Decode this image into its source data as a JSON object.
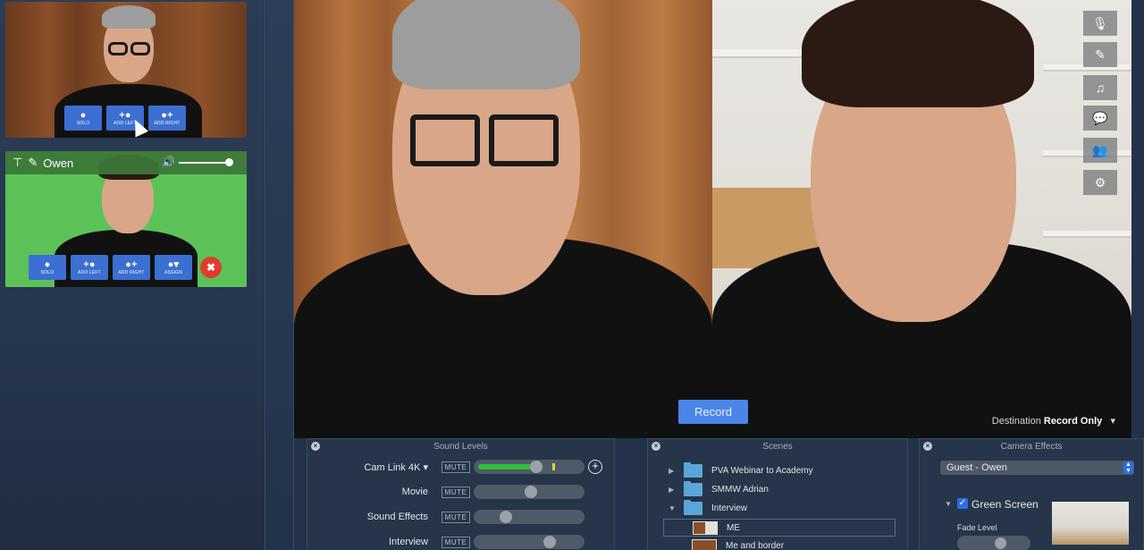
{
  "sidebar": {
    "host_thumb": {
      "buttons": [
        {
          "icon": "person-icon",
          "glyph": "👤",
          "label": "SOLO"
        },
        {
          "icon": "add-left-icon",
          "glyph": "+👤",
          "label": "ADD LEFT"
        },
        {
          "icon": "add-right-icon",
          "glyph": "👤+",
          "label": "ADD RIGHT"
        }
      ]
    },
    "guest_thumb": {
      "name": "Owen",
      "volume": 1.0,
      "buttons": [
        {
          "icon": "person-icon",
          "glyph": "👤",
          "label": "SOLO"
        },
        {
          "icon": "add-left-icon",
          "glyph": "+👤",
          "label": "ADD LEFT"
        },
        {
          "icon": "add-right-icon",
          "glyph": "👤+",
          "label": "ADD RIGHT"
        },
        {
          "icon": "assign-icon",
          "glyph": "👤▾",
          "label": "ASSIGN"
        }
      ],
      "remove_glyph": "✖"
    }
  },
  "stage": {
    "record_label": "Record",
    "destination_label": "Destination",
    "destination_value": "Record Only",
    "tools": [
      {
        "name": "audio-settings-icon",
        "glyph": "🎙"
      },
      {
        "name": "magic-wand-icon",
        "glyph": "✎"
      },
      {
        "name": "music-icon",
        "glyph": "♫"
      },
      {
        "name": "chat-icon",
        "glyph": "💬"
      },
      {
        "name": "guests-icon",
        "glyph": "👥"
      },
      {
        "name": "settings-gear-icon",
        "glyph": "⚙"
      }
    ]
  },
  "sound_levels": {
    "title": "Sound Levels",
    "rows": [
      {
        "label": "Cam Link 4K ▾",
        "mute": "MUTE",
        "level": 0.58,
        "meter": 0.58,
        "has_add": true
      },
      {
        "label": "Movie",
        "mute": "MUTE",
        "level": 0.52
      },
      {
        "label": "Sound Effects",
        "mute": "MUTE",
        "level": 0.25
      },
      {
        "label": "Interview",
        "mute": "MUTE",
        "level": 0.72
      }
    ],
    "add_glyph": "+"
  },
  "scenes": {
    "title": "Scenes",
    "folders": [
      {
        "name": "PVA Webinar to Academy",
        "expanded": false
      },
      {
        "name": "SMMW Adrian",
        "expanded": false
      },
      {
        "name": "Interview",
        "expanded": true
      }
    ],
    "items": [
      {
        "name": "ME",
        "selected": true
      },
      {
        "name": "Me and border",
        "selected": false
      }
    ]
  },
  "camera_effects": {
    "title": "Camera Effects",
    "source": "Guest - Owen",
    "effect_label": "Green Screen",
    "effect_enabled": true,
    "fade_label": "Fade Level",
    "fade_level": 0.6
  }
}
